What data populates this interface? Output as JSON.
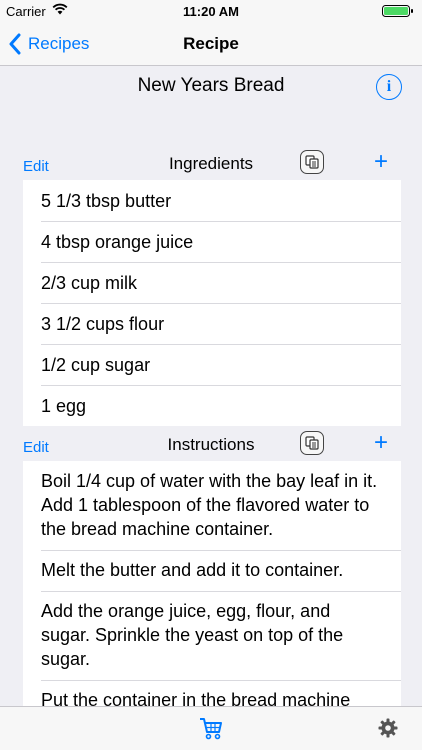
{
  "status_bar": {
    "carrier": "Carrier",
    "time": "11:20 AM",
    "icons": [
      "wifi-icon",
      "battery-icon"
    ]
  },
  "nav": {
    "back_label": "Recipes",
    "title": "Recipe"
  },
  "recipe": {
    "name": "New Years Bread"
  },
  "ingredients": {
    "edit_label": "Edit",
    "title": "Ingredients",
    "add_label": "+",
    "items": [
      "5 1/3 tbsp butter",
      "4 tbsp orange juice",
      "2/3 cup milk",
      "3 1/2 cups flour",
      "1/2 cup sugar",
      "1 egg"
    ]
  },
  "instructions": {
    "edit_label": "Edit",
    "title": "Instructions",
    "add_label": "+",
    "items": [
      "Boil 1/4 cup of water with the bay leaf in it. Add 1 tablespoon of the flavored water to the bread machine container.",
      "Melt the butter and add it to container.",
      "Add the orange juice, egg, flour, and sugar. Sprinkle the yeast on top of the sugar.",
      "Put the container in the bread machine"
    ]
  },
  "tab_bar": {
    "icons": [
      "cart-icon",
      "gear-icon"
    ]
  },
  "colors": {
    "accent": "#007aff",
    "background": "#efeff4"
  }
}
